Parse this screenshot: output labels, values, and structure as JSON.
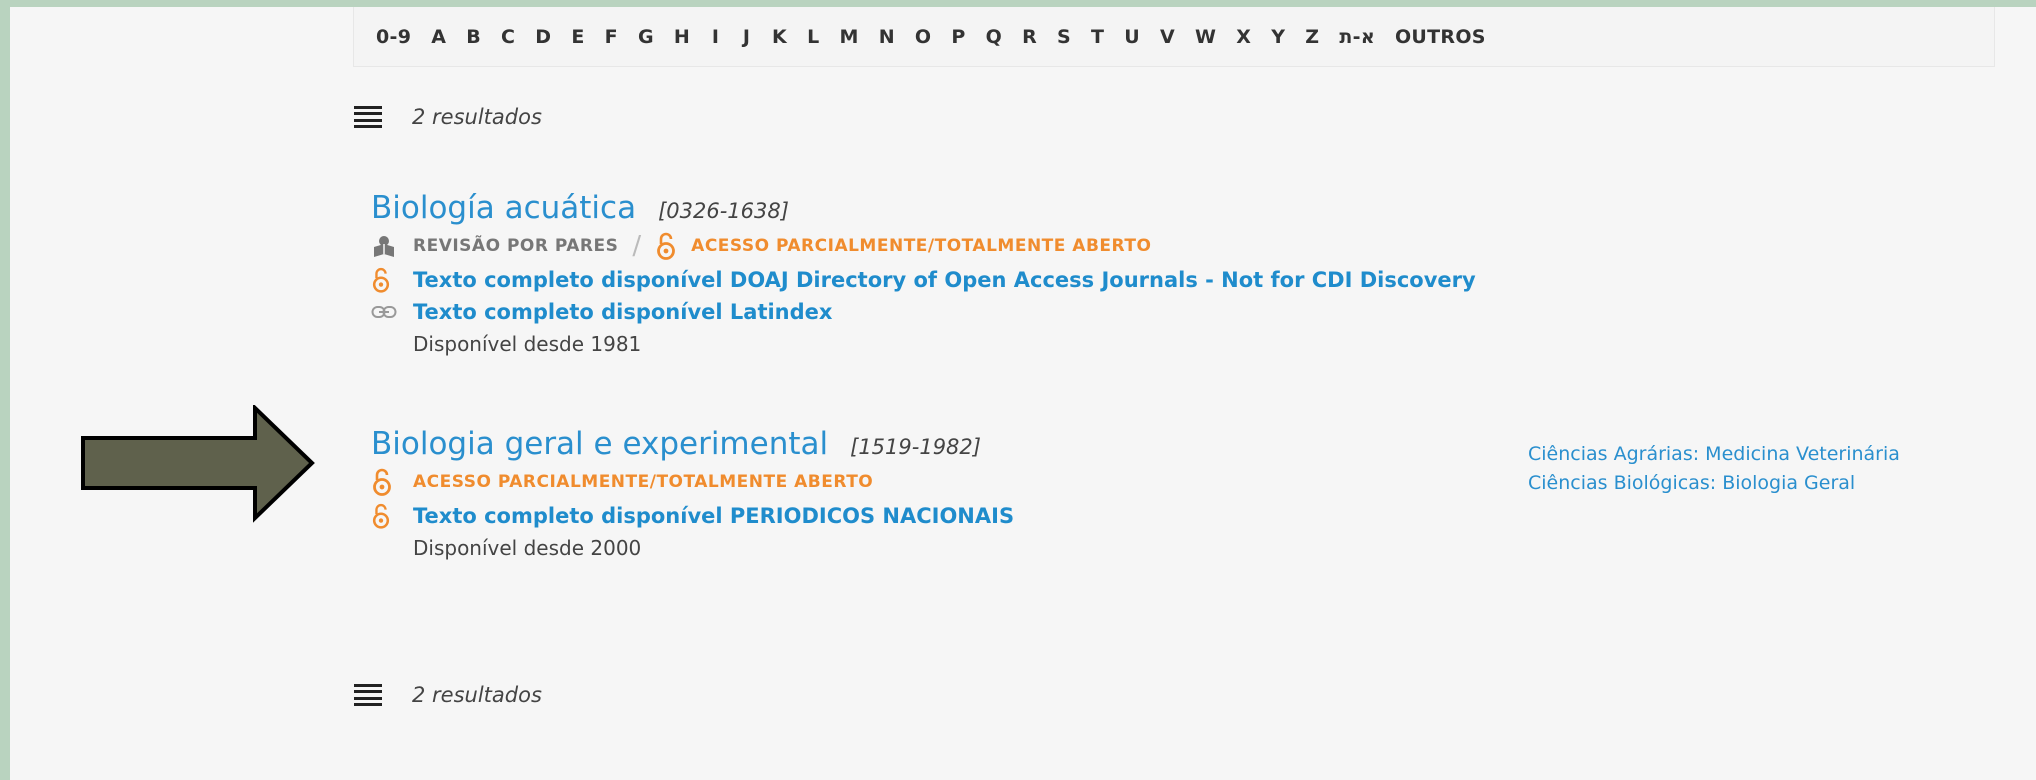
{
  "alphabet": [
    "0-9",
    "A",
    "B",
    "C",
    "D",
    "E",
    "F",
    "G",
    "H",
    "I",
    "J",
    "K",
    "L",
    "M",
    "N",
    "O",
    "P",
    "Q",
    "R",
    "S",
    "T",
    "U",
    "V",
    "W",
    "X",
    "Y",
    "Z",
    "א-ת",
    "OUTROS"
  ],
  "results_top": "2 resultados",
  "results_bottom": "2 resultados",
  "records": [
    {
      "title": "Biología acuática",
      "issn": "[0326-1638]",
      "peer_review": "REVISÃO POR PARES",
      "open_access": "ACESSO PARCIALMENTE/TOTALMENTE ABERTO",
      "links": [
        {
          "icon": "open-lock-icon",
          "text": "Texto completo disponível DOAJ Directory of Open Access Journals - Not for CDI Discovery"
        },
        {
          "icon": "link-icon",
          "text": "Texto completo disponível Latindex"
        }
      ],
      "available": "Disponível desde 1981"
    },
    {
      "title": "Biologia geral e experimental",
      "issn": "[1519-1982]",
      "open_access": "ACESSO PARCIALMENTE/TOTALMENTE ABERTO",
      "links": [
        {
          "icon": "open-lock-icon",
          "text": "Texto completo disponível PERIODICOS NACIONAIS"
        }
      ],
      "available": "Disponível desde 2000",
      "subjects": [
        "Ciências Agrárias: Medicina Veterinária",
        "Ciências Biológicas: Biologia Geral"
      ]
    }
  ],
  "colors": {
    "link": "#2a8fce",
    "open_access": "#f08c2e",
    "arrow_fill": "#5f614c",
    "frame": "#b9d3bf"
  }
}
